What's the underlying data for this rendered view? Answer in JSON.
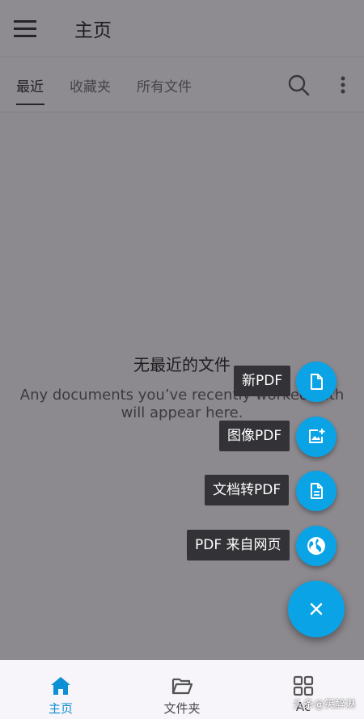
{
  "appbar": {
    "title": "主页"
  },
  "tabs": [
    {
      "label": "最近",
      "active": true
    },
    {
      "label": "收藏夹",
      "active": false
    },
    {
      "label": "所有文件",
      "active": false
    }
  ],
  "empty_state": {
    "title": "无最近的文件",
    "line1": "Any documents you’ve recently worked with",
    "line2": "will appear here."
  },
  "fab_menu": {
    "items": [
      {
        "label": "新PDF",
        "icon": "file-icon"
      },
      {
        "label": "图像PDF",
        "icon": "image-add-icon"
      },
      {
        "label": "文档转PDF",
        "icon": "document-icon"
      },
      {
        "label": "PDF 来自网页",
        "icon": "globe-icon"
      }
    ],
    "close_icon": "close-icon"
  },
  "bottom_nav": [
    {
      "label": "主页",
      "icon": "home-icon",
      "active": true
    },
    {
      "label": "文件夹",
      "icon": "folder-open-icon",
      "active": false
    },
    {
      "label": "Ac",
      "icon": "apps-grid-icon",
      "active": false
    }
  ],
  "watermark": "头条@笑醉淋",
  "colors": {
    "accent": "#0aa3e6",
    "active_nav": "#0c8fd3",
    "scrim": "rgba(25,22,28,0.47)",
    "tooltip_bg": "#333236"
  }
}
